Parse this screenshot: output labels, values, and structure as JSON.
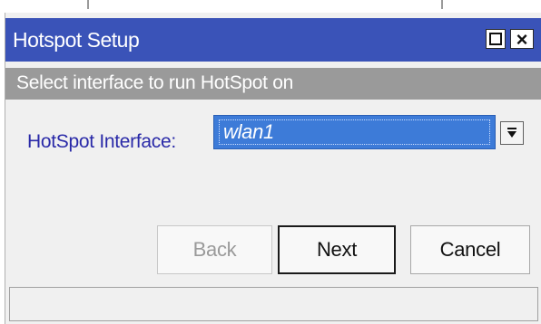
{
  "window": {
    "title": "Hotspot Setup",
    "maximize_icon": "maximize-icon",
    "close_icon": "close-icon",
    "close_glyph": "×"
  },
  "header": {
    "text": "Select interface to run HotSpot on"
  },
  "form": {
    "label": "HotSpot Interface:",
    "selected_value": "wlan1",
    "dropdown_icon": "dropdown-arrow-icon"
  },
  "buttons": {
    "back": "Back",
    "next": "Next",
    "cancel": "Cancel"
  },
  "status_bar": {
    "text": ""
  },
  "colors": {
    "titlebar": "#3a53b8",
    "header_band": "#9a9a9a",
    "selection": "#3d7bd8",
    "label_text": "#2a2aa8"
  }
}
